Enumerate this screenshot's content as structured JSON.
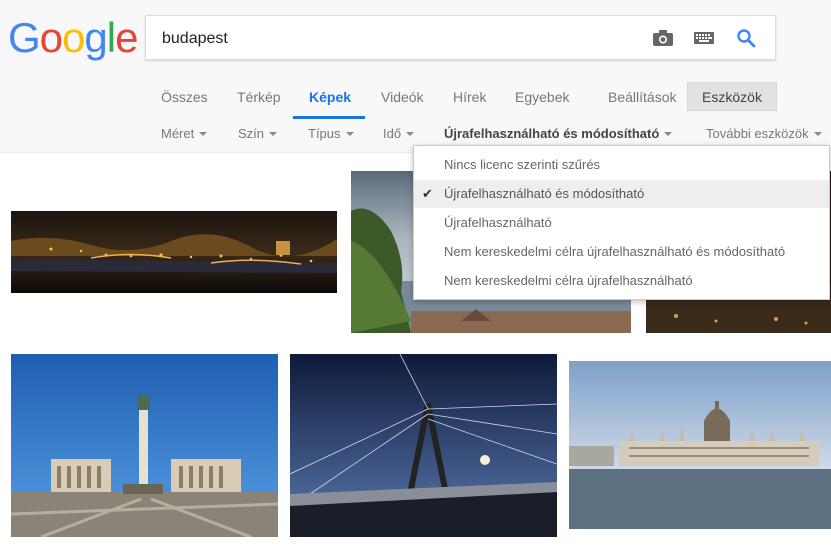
{
  "logo": {
    "letters": [
      "G",
      "o",
      "o",
      "g",
      "l",
      "e"
    ],
    "colors": [
      "#4285F4",
      "#EA4335",
      "#FBBC05",
      "#4285F4",
      "#34A853",
      "#EA4335"
    ]
  },
  "search": {
    "value": "budapest"
  },
  "icons": {
    "camera": "camera-icon",
    "keyboard": "keyboard-icon",
    "search": "search-icon"
  },
  "tabs": [
    "Összes",
    "Térkép",
    "Képek",
    "Videók",
    "Hírek",
    "Egyebek",
    "Beállítások"
  ],
  "active_tab": "Képek",
  "tools_label": "Eszközök",
  "filters": [
    "Méret",
    "Szín",
    "Típus",
    "Idő",
    "Újrafelhasználható és módosítható",
    "További eszközök"
  ],
  "license_menu": {
    "items": [
      "Nincs licenc szerinti szűrés",
      "Újrafelhasználható és módosítható",
      "Újrafelhasználható",
      "Nem kereskedelmi célra újrafelhasználható és módosítható",
      "Nem kereskedelmi célra újrafelhasználható"
    ],
    "selected_index": 1
  },
  "colors": {
    "accent": "#1a73e8"
  }
}
